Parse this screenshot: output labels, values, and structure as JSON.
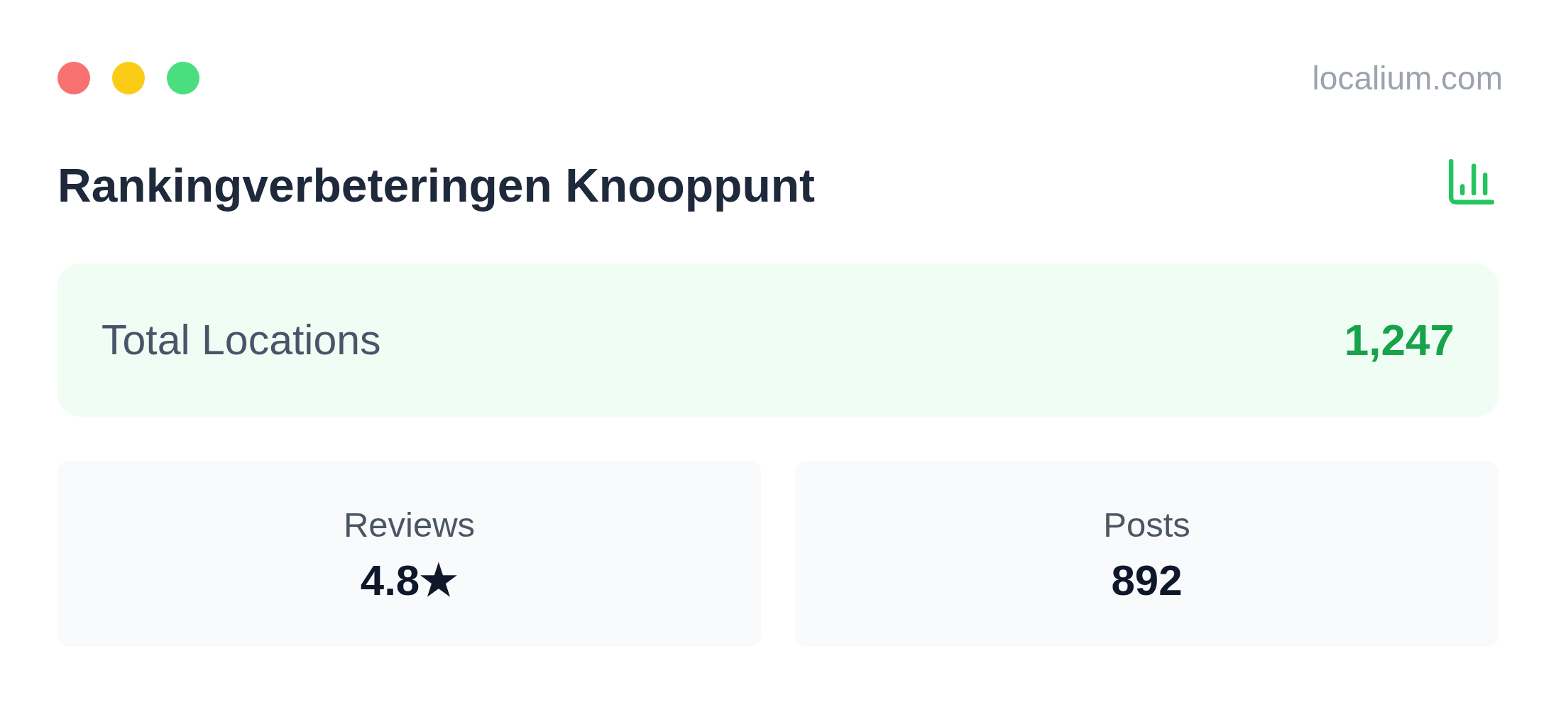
{
  "window": {
    "controls": [
      {
        "color": "#f87171"
      },
      {
        "color": "#facc15"
      },
      {
        "color": "#4ade80"
      }
    ],
    "domain": "localium.com"
  },
  "header": {
    "title": "Rankingverbeteringen Knooppunt"
  },
  "total": {
    "label": "Total Locations",
    "value": "1,247"
  },
  "stats": [
    {
      "label": "Reviews",
      "value": "4.8★"
    },
    {
      "label": "Posts",
      "value": "892"
    }
  ]
}
